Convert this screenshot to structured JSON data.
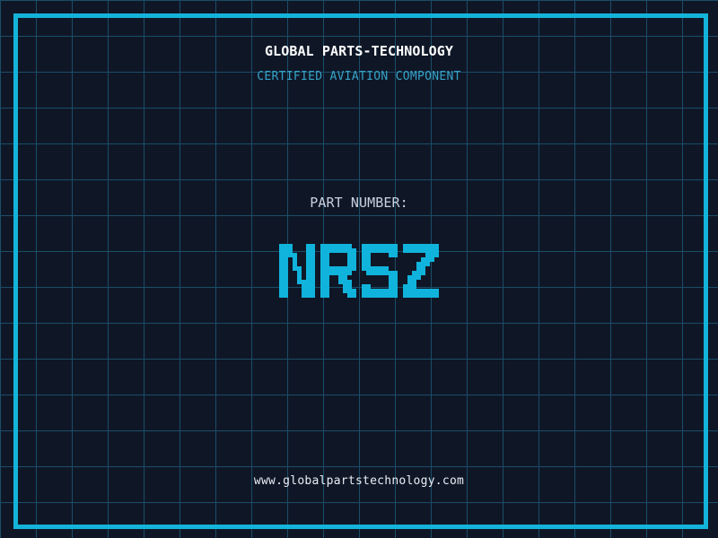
{
  "colors": {
    "background": "#0F1727",
    "grid_line": "#1B4D67",
    "frame": "#14B3DA",
    "title": "#FFFFFF",
    "subtitle": "#37A3C8",
    "part_label": "#C9D2DE",
    "part_number": "#10B3DB",
    "url": "#EAEEF4"
  },
  "header": {
    "company": "GLOBAL PARTS-TECHNOLOGY",
    "tagline": "CERTIFIED AVIATION COMPONENT"
  },
  "part": {
    "label": "PART NUMBER:",
    "number": "NRSZ"
  },
  "footer": {
    "website": "www.globalpartstechnology.com"
  }
}
